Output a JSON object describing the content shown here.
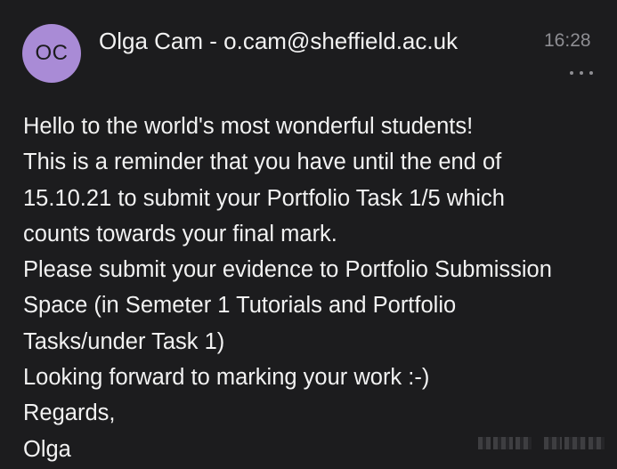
{
  "message": {
    "avatar_initials": "OC",
    "sender": "Olga Cam - o.cam@sheffield.ac.uk",
    "time": "16:28",
    "more_icon": "more-horizontal-icon",
    "avatar_color": "#a98bd6",
    "background_color": "#1c1c1e",
    "body_lines": [
      "Hello to the world's most wonderful students!",
      "This is a reminder that you have until the end of",
      "15.10.21 to submit your Portfolio Task 1/5 which",
      "counts towards your final mark.",
      "Please submit your evidence to Portfolio Submission",
      "Space (in Semeter 1 Tutorials and Portfolio",
      "Tasks/under Task 1)",
      "Looking forward to marking your work :-)",
      "Regards,",
      "Olga"
    ]
  }
}
